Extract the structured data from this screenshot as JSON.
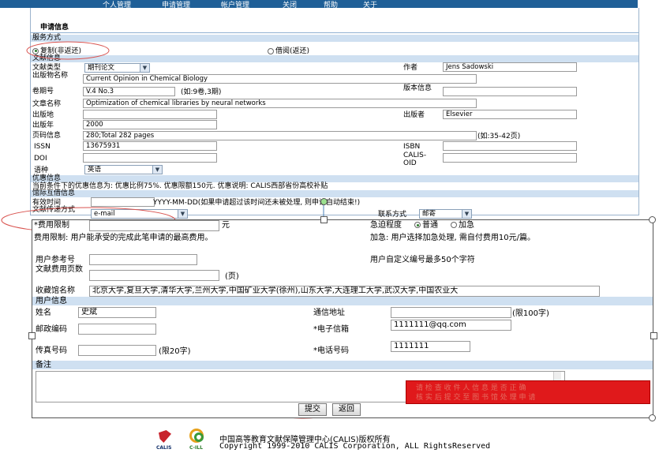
{
  "nav": {
    "items": [
      "个人管理",
      "申请管理",
      "帐户管理",
      "关闭",
      "帮助",
      "关于"
    ]
  },
  "section_title": "申请信息",
  "service": {
    "header": "服务方式",
    "options": [
      {
        "label": "复制(非返还)",
        "checked": true
      },
      {
        "label": "借阅(返还)",
        "checked": false
      }
    ]
  },
  "doc_info": {
    "header": "文献信息",
    "doc_type_label": "文献类型",
    "doc_type_value": "期刊论文",
    "author_label": "作者",
    "author_value": "Jens Sadowski",
    "publication_label": "出版物名称",
    "publication_value": "Current Opinion in Chemical Biology",
    "volume_label": "卷期号",
    "volume_value": "V.4 No.3",
    "volume_hint": "(如:9卷,3期)",
    "edition_label": "版本信息",
    "edition_value": "",
    "article_label": "文章名称",
    "article_value": "Optimization of chemical libraries by neural networks",
    "place_label": "出版地",
    "place_value": "",
    "publisher_label": "出版者",
    "publisher_value": "Elsevier",
    "year_label": "出版年",
    "year_value": "2000",
    "pages_label": "页码信息",
    "pages_value": "280;Total 282 pages",
    "pages_hint": "(如:35-42页)",
    "issn_label": "ISSN",
    "issn_value": "13675931",
    "isbn_label": "ISBN",
    "isbn_value": "",
    "doi_label": "DOI",
    "doi_value": "",
    "oid_label": "CALIS-OID",
    "oid_value": "",
    "lang_label": "语种",
    "lang_value": "英语"
  },
  "discount": {
    "header": "优惠信息",
    "text": "当前条件下的优惠信息为: 优惠比例75%. 优惠限额150元. 优惠说明: CALIS西部省份高校补贴"
  },
  "ill": {
    "header": "馆际互借信息",
    "valid_label": "有效时间",
    "valid_value": "",
    "valid_hint": "YYYY-MM-DD(如果申请超过该时间还未被处理, 则申请自动结束!)",
    "delivery_label": "文献传递方式",
    "delivery_value": "e-mail",
    "contact_label": "联系方式",
    "contact_value": "邮寄",
    "fee_label": "*费用限制",
    "fee_value": "",
    "fee_unit": "元",
    "urgency_label": "急迫程度",
    "urgency_options": [
      {
        "label": "普通",
        "checked": true
      },
      {
        "label": "加急",
        "checked": false
      }
    ],
    "fee_note": "费用限制: 用户能承受的完成此笔申请的最高费用。",
    "urgent_note": "加急: 用户选择加急处理, 需自付费用10元/篇。",
    "ref_label": "用户参考号",
    "ref_value": "",
    "ref_note": "用户自定义编号最多50个字符",
    "doc_pages_label": "文献费用页数",
    "doc_pages_value": "",
    "doc_pages_unit": "(页)",
    "holdings_label": "收藏馆名称",
    "holdings_value": "北京大学,复旦大学,清华大学,兰州大学,中国矿业大学(徐州),山东大学,大连理工大学,武汉大学,中国农业大"
  },
  "user_info": {
    "header": "用户信息",
    "name_label": "姓名",
    "name_value": "史斌",
    "address_label": "通信地址",
    "address_value": "",
    "address_hint": "(限100字)",
    "postcode_label": "邮政编码",
    "postcode_value": "",
    "email_label": "*电子信箱",
    "email_value": "1111111@qq.com",
    "fax_label": "传真号码",
    "fax_value": "",
    "fax_hint": "(限20字)",
    "phone_label": "*电话号码",
    "phone_value": "1111111"
  },
  "notes": {
    "header": "备注",
    "value": ""
  },
  "buttons": {
    "submit": "提交",
    "back": "返回"
  },
  "red_box_text": [
    "请 检 查 收 件 人 信 息 是 否 正 确",
    "核 实 后 提 交 至 图 书 馆 处 理 申 请"
  ],
  "footer": {
    "line1": "中国高等教育文献保障管理中心(CALIS)版权所有",
    "line2": "Copyright 1999-2010 CALIS Corporation, ALL RightsReserved",
    "logo1": "CALIS",
    "logo2": "C-ILL"
  },
  "colors": {
    "nav_bg": "#1f5f97",
    "band": "#cfe0f1",
    "red_box": "#e0191b",
    "annotation": "#d9534f"
  }
}
